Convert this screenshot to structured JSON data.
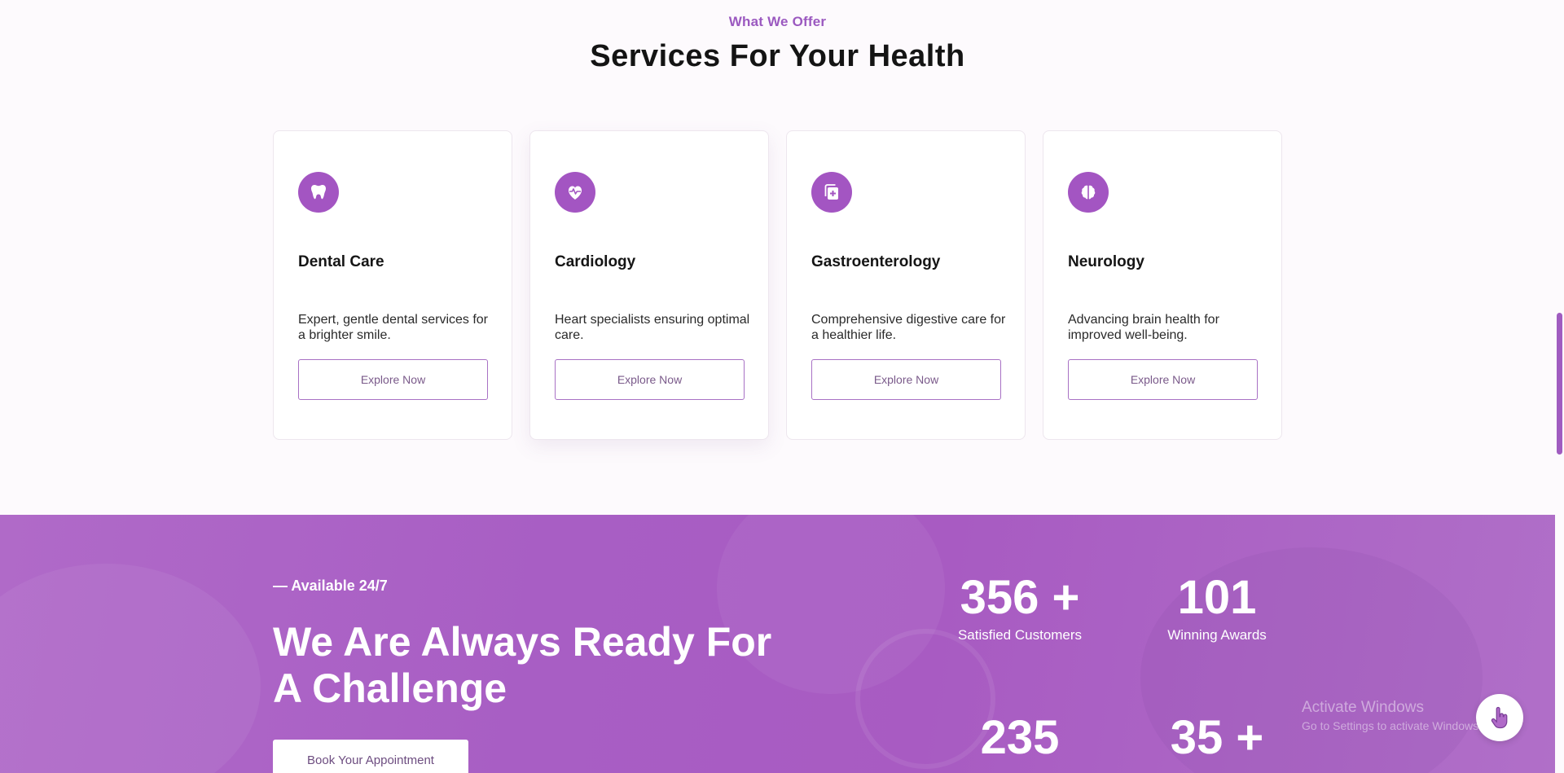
{
  "services": {
    "eyebrow": "What We Offer",
    "title": "Services For Your Health",
    "cards": [
      {
        "icon": "tooth-icon",
        "title": "Dental Care",
        "description": "Expert, gentle dental services for a brighter smile.",
        "button": "Explore Now"
      },
      {
        "icon": "heartbeat-icon",
        "title": "Cardiology",
        "description": "Heart specialists ensuring optimal care.",
        "button": "Explore Now"
      },
      {
        "icon": "medical-file-icon",
        "title": "Gastroenterology",
        "description": "Comprehensive digestive care for a healthier life.",
        "button": "Explore Now"
      },
      {
        "icon": "brain-icon",
        "title": "Neurology",
        "description": "Advancing brain health for improved well-being.",
        "button": "Explore Now"
      }
    ]
  },
  "banner": {
    "tag": "— Available 24/7",
    "headline": "We Are Always Ready For A Challenge",
    "book_button": "Book Your Appointment",
    "stats": [
      {
        "number": "356 +",
        "label": "Satisfied Customers"
      },
      {
        "number": "101",
        "label": "Winning Awards"
      },
      {
        "number": "235",
        "label": ""
      },
      {
        "number": "35 +",
        "label": ""
      }
    ]
  },
  "os_watermark": {
    "line1": "Activate Windows",
    "line2": "Go to Settings to activate Windows."
  },
  "colors": {
    "accent": "#a355c2",
    "banner_bg": "#ab5fc4",
    "page_bg": "#fdfafd"
  }
}
